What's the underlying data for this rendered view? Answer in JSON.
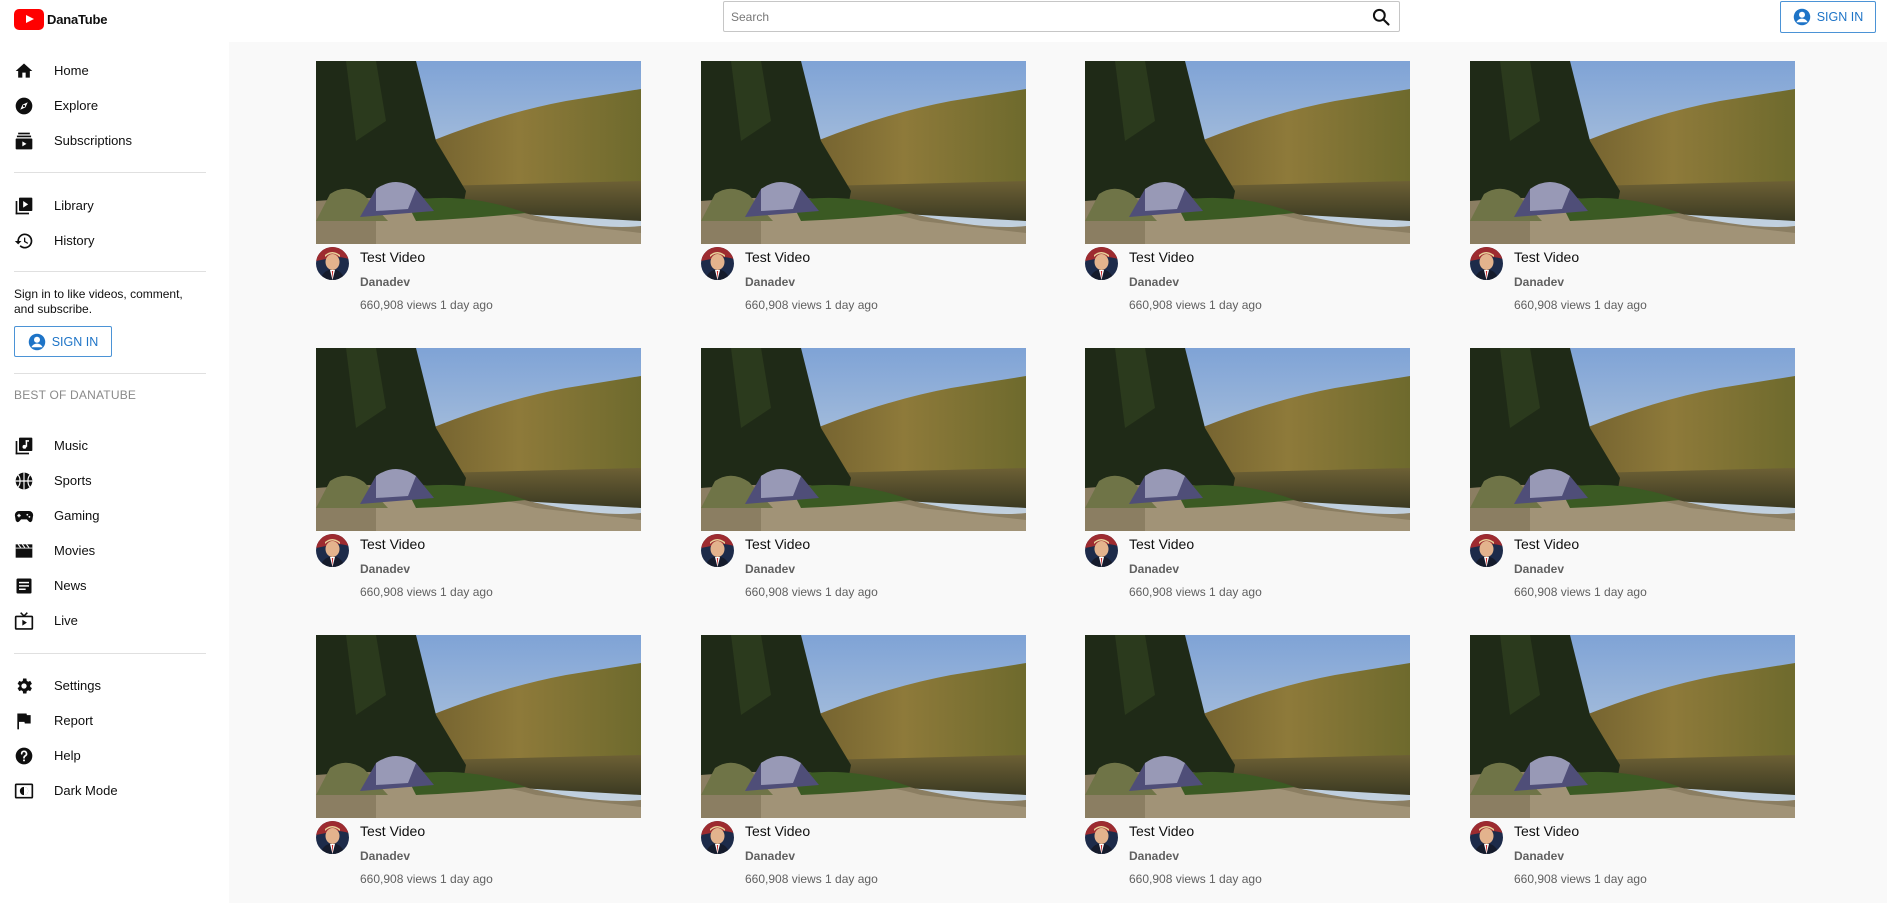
{
  "app": {
    "name": "DanaTube"
  },
  "search": {
    "placeholder": "Search"
  },
  "header": {
    "sign_in_label": "SIGN IN"
  },
  "sidebar": {
    "primary": [
      {
        "label": "Home",
        "icon": "home-icon"
      },
      {
        "label": "Explore",
        "icon": "compass-icon"
      },
      {
        "label": "Subscriptions",
        "icon": "subscriptions-icon"
      }
    ],
    "secondary": [
      {
        "label": "Library",
        "icon": "library-icon"
      },
      {
        "label": "History",
        "icon": "history-icon"
      }
    ],
    "sign_in_message": "Sign in to like videos, comment, and subscribe.",
    "sign_in_label": "SIGN IN",
    "section_title": "BEST OF DANATUBE",
    "best_of": [
      {
        "label": "Music",
        "icon": "music-icon"
      },
      {
        "label": "Sports",
        "icon": "sports-icon"
      },
      {
        "label": "Gaming",
        "icon": "gaming-icon"
      },
      {
        "label": "Movies",
        "icon": "movies-icon"
      },
      {
        "label": "News",
        "icon": "news-icon"
      },
      {
        "label": "Live",
        "icon": "live-icon"
      }
    ],
    "footer": [
      {
        "label": "Settings",
        "icon": "gear-icon"
      },
      {
        "label": "Report",
        "icon": "flag-icon"
      },
      {
        "label": "Help",
        "icon": "help-icon"
      },
      {
        "label": "Dark Mode",
        "icon": "dark-mode-icon"
      }
    ]
  },
  "videos": [
    {
      "title": "Test Video",
      "channel": "Danadev",
      "meta": "660,908 views 1 day ago"
    },
    {
      "title": "Test Video",
      "channel": "Danadev",
      "meta": "660,908 views 1 day ago"
    },
    {
      "title": "Test Video",
      "channel": "Danadev",
      "meta": "660,908 views 1 day ago"
    },
    {
      "title": "Test Video",
      "channel": "Danadev",
      "meta": "660,908 views 1 day ago"
    },
    {
      "title": "Test Video",
      "channel": "Danadev",
      "meta": "660,908 views 1 day ago"
    },
    {
      "title": "Test Video",
      "channel": "Danadev",
      "meta": "660,908 views 1 day ago"
    },
    {
      "title": "Test Video",
      "channel": "Danadev",
      "meta": "660,908 views 1 day ago"
    },
    {
      "title": "Test Video",
      "channel": "Danadev",
      "meta": "660,908 views 1 day ago"
    },
    {
      "title": "Test Video",
      "channel": "Danadev",
      "meta": "660,908 views 1 day ago"
    },
    {
      "title": "Test Video",
      "channel": "Danadev",
      "meta": "660,908 views 1 day ago"
    },
    {
      "title": "Test Video",
      "channel": "Danadev",
      "meta": "660,908 views 1 day ago"
    },
    {
      "title": "Test Video",
      "channel": "Danadev",
      "meta": "660,908 views 1 day ago"
    }
  ],
  "colors": {
    "brand": "#ff0000",
    "accent": "#1e74c7",
    "main_bg": "#f9f9f9"
  }
}
